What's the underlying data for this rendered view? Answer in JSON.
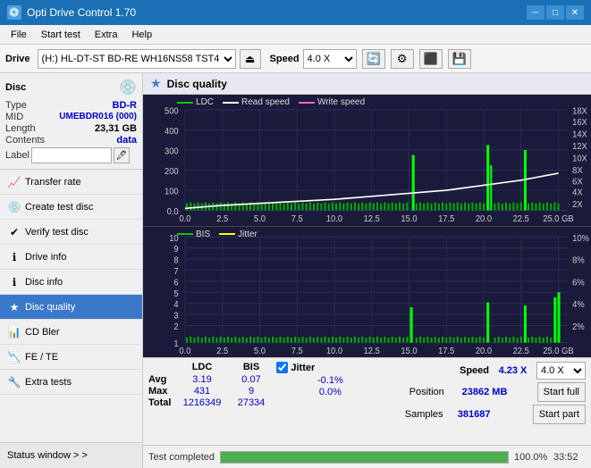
{
  "app": {
    "title": "Opti Drive Control 1.70",
    "icon": "💿"
  },
  "titlebar": {
    "minimize": "─",
    "maximize": "□",
    "close": "✕"
  },
  "menu": {
    "items": [
      "File",
      "Start test",
      "Extra",
      "Help"
    ]
  },
  "toolbar": {
    "drive_label": "Drive",
    "drive_value": "(H:)  HL-DT-ST BD-RE  WH16NS58 TST4",
    "speed_label": "Speed",
    "speed_value": "4.0 X"
  },
  "disc_panel": {
    "title": "Disc",
    "type_label": "Type",
    "type_value": "BD-R",
    "mid_label": "MID",
    "mid_value": "UMEBDR016 (000)",
    "length_label": "Length",
    "length_value": "23,31 GB",
    "contents_label": "Contents",
    "contents_value": "data",
    "label_label": "Label",
    "label_value": ""
  },
  "nav": {
    "items": [
      {
        "id": "transfer-rate",
        "label": "Transfer rate",
        "icon": "📈"
      },
      {
        "id": "create-test-disc",
        "label": "Create test disc",
        "icon": "💿"
      },
      {
        "id": "verify-test-disc",
        "label": "Verify test disc",
        "icon": "✔"
      },
      {
        "id": "drive-info",
        "label": "Drive info",
        "icon": "ℹ"
      },
      {
        "id": "disc-info",
        "label": "Disc info",
        "icon": "ℹ"
      },
      {
        "id": "disc-quality",
        "label": "Disc quality",
        "icon": "★",
        "active": true
      },
      {
        "id": "cd-bler",
        "label": "CD Bler",
        "icon": "📊"
      },
      {
        "id": "fe-te",
        "label": "FE / TE",
        "icon": "📉"
      },
      {
        "id": "extra-tests",
        "label": "Extra tests",
        "icon": "🔧"
      }
    ]
  },
  "status_window": {
    "label": "Status window > >"
  },
  "disc_quality": {
    "title": "Disc quality",
    "legend": {
      "ldc": "LDC",
      "read_speed": "Read speed",
      "write_speed": "Write speed",
      "bis": "BIS",
      "jitter": "Jitter"
    }
  },
  "top_chart": {
    "y_left_labels": [
      "500",
      "400",
      "300",
      "200",
      "100",
      "0.0"
    ],
    "y_right_labels": [
      "18X",
      "16X",
      "14X",
      "12X",
      "10X",
      "8X",
      "6X",
      "4X",
      "2X"
    ],
    "x_labels": [
      "0.0",
      "2.5",
      "5.0",
      "7.5",
      "10.0",
      "12.5",
      "15.0",
      "17.5",
      "20.0",
      "22.5",
      "25.0 GB"
    ]
  },
  "bottom_chart": {
    "y_left_labels": [
      "10",
      "9",
      "8",
      "7",
      "6",
      "5",
      "4",
      "3",
      "2",
      "1"
    ],
    "y_right_labels": [
      "10%",
      "8%",
      "6%",
      "4%",
      "2%"
    ],
    "x_labels": [
      "0.0",
      "2.5",
      "5.0",
      "7.5",
      "10.0",
      "12.5",
      "15.0",
      "17.5",
      "20.0",
      "22.5",
      "25.0 GB"
    ]
  },
  "stats": {
    "col_ldc": "LDC",
    "col_bis": "BIS",
    "col_jitter": "Jitter",
    "col_speed": "Speed",
    "row_avg_label": "Avg",
    "row_avg_ldc": "3.19",
    "row_avg_bis": "0.07",
    "row_avg_jitter": "-0.1%",
    "row_max_label": "Max",
    "row_max_ldc": "431",
    "row_max_bis": "9",
    "row_max_jitter": "0.0%",
    "row_total_label": "Total",
    "row_total_ldc": "1216349",
    "row_total_bis": "27334",
    "speed_value": "4.23 X",
    "speed_select": "4.0 X",
    "position_label": "Position",
    "position_value": "23862 MB",
    "samples_label": "Samples",
    "samples_value": "381687",
    "btn_start_full": "Start full",
    "btn_start_part": "Start part"
  },
  "progress": {
    "percent": 100,
    "percent_text": "100.0%"
  },
  "status_bar": {
    "text": "Test completed",
    "time": "33:52"
  },
  "colors": {
    "accent_blue": "#3a78c9",
    "chart_bg": "#1a1a3a",
    "ldc_color": "#00cc00",
    "read_speed_color": "#ffffff",
    "write_speed_color": "#ff69b4",
    "bis_color": "#00cc00",
    "jitter_color": "#ffff00",
    "grid_color": "#2a2a5a"
  }
}
